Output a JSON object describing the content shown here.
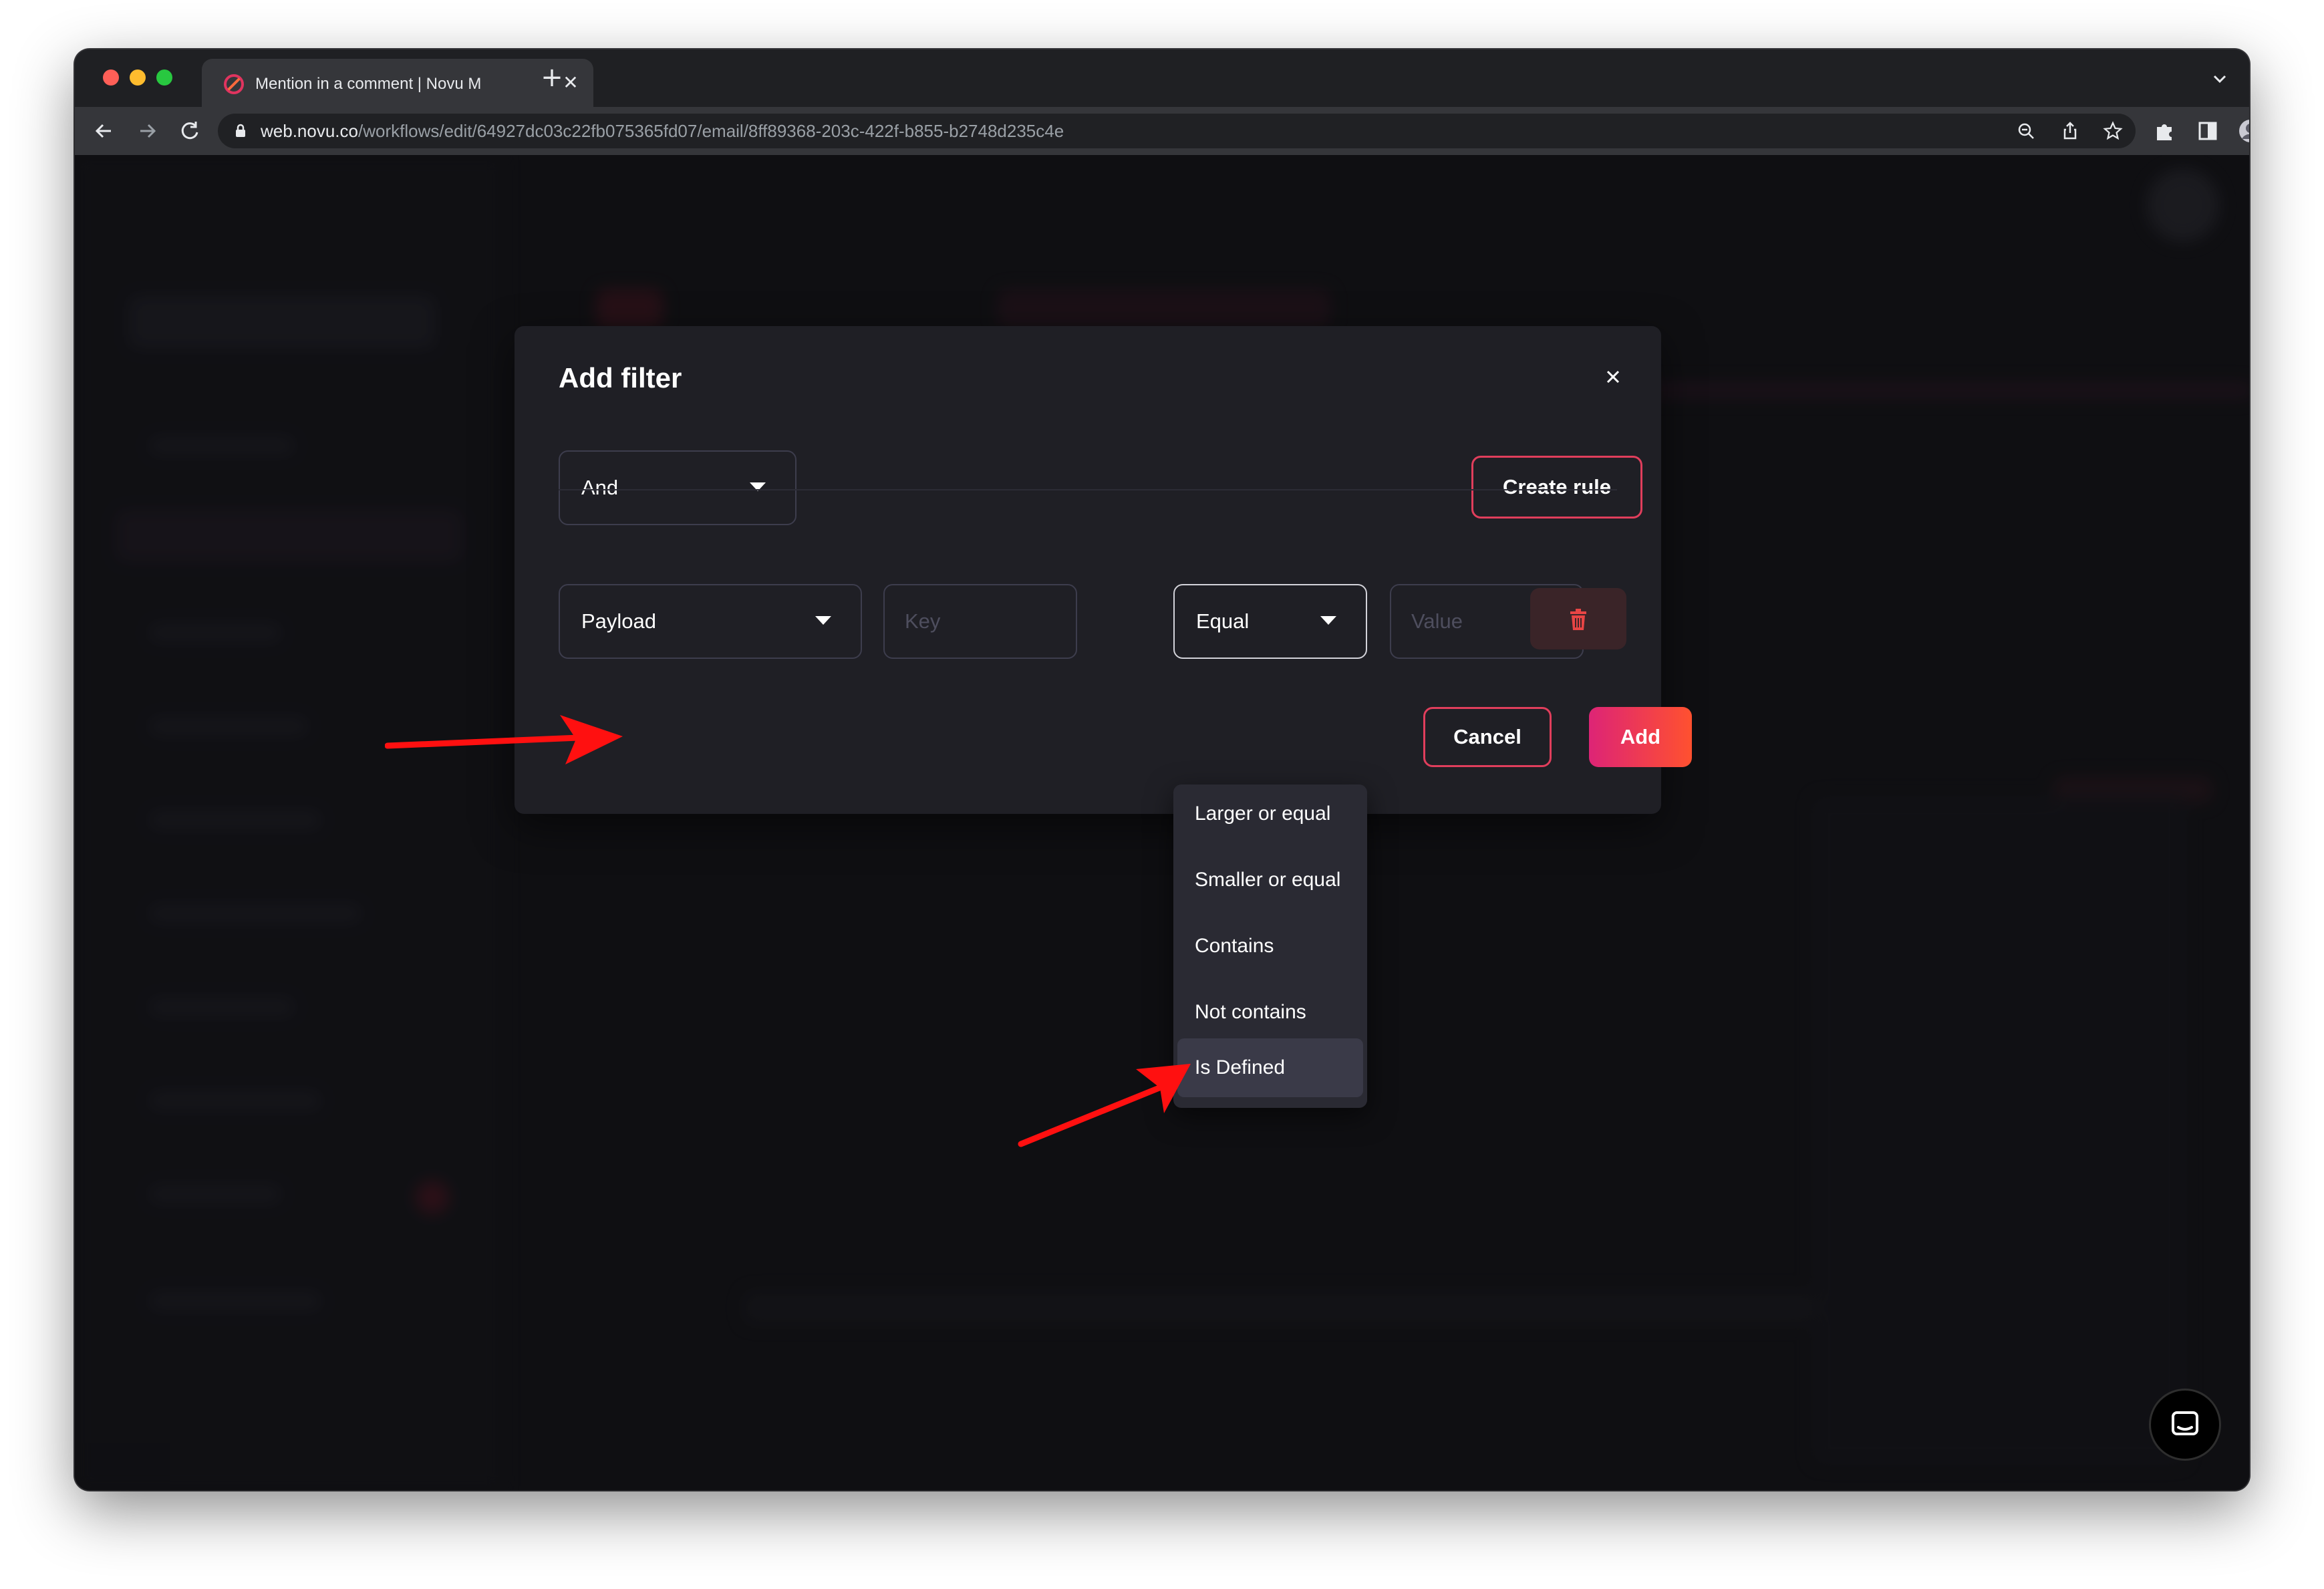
{
  "browser": {
    "tab": {
      "title": "Mention in a comment | Novu M",
      "favicon": "novu-logo-icon"
    },
    "url": {
      "host": "web.novu.co",
      "path": "/workflows/edit/64927dc03c22fb075365fd07/email/8ff89368-203c-422f-b855-b2748d235c4e"
    }
  },
  "modal": {
    "title": "Add filter",
    "group_operator": "And",
    "create_rule_label": "Create rule",
    "rule": {
      "on": "Payload",
      "key_placeholder": "Key",
      "operator": "Equal",
      "value_placeholder": "Value"
    },
    "cancel_label": "Cancel",
    "add_label": "Add"
  },
  "operator_dropdown": {
    "items": [
      "Larger or equal",
      "Smaller or equal",
      "Contains",
      "Not contains",
      "Is Defined"
    ],
    "highlighted": "Is Defined"
  },
  "colors": {
    "accent_gradient_start": "#dd2476",
    "accent_gradient_end": "#ff512f",
    "annotation_arrow": "#ff0000",
    "modal_bg": "#1f1f25"
  }
}
